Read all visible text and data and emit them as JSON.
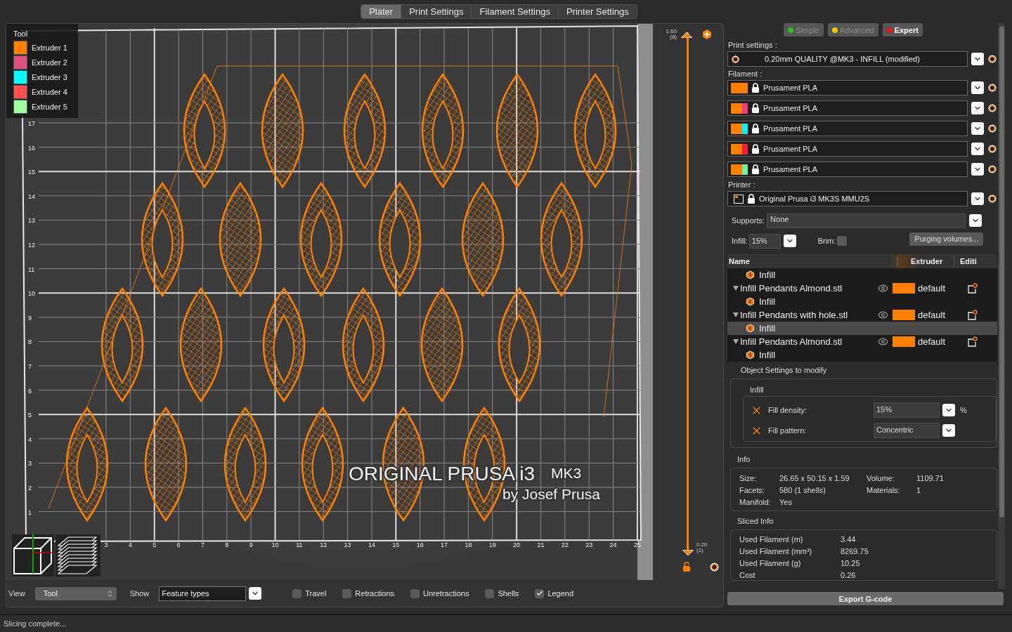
{
  "tabs": [
    {
      "label": "Plater",
      "selected": true
    },
    {
      "label": "Print Settings",
      "selected": false
    },
    {
      "label": "Filament Settings",
      "selected": false
    },
    {
      "label": "Printer Settings",
      "selected": false
    }
  ],
  "viewport": {
    "legend": {
      "title": "Tool",
      "items": [
        {
          "label": "Extruder 1",
          "color": "#ff7f00"
        },
        {
          "label": "Extruder 2",
          "color": "#e0507f"
        },
        {
          "label": "Extruder 3",
          "color": "#00ffff"
        },
        {
          "label": "Extruder 4",
          "color": "#ff4f4f"
        },
        {
          "label": "Extruder 5",
          "color": "#9eff9e"
        }
      ]
    },
    "y_axis": [
      "17",
      "16",
      "15",
      "14",
      "13",
      "12",
      "11",
      "10",
      "9",
      "8",
      "7",
      "6",
      "5",
      "4",
      "3",
      "2",
      "1"
    ],
    "x_axis": [
      "3",
      "4",
      "5",
      "6",
      "7",
      "8",
      "9",
      "10",
      "11",
      "12",
      "13",
      "14",
      "15",
      "16",
      "17",
      "18",
      "19",
      "20",
      "21",
      "22",
      "23",
      "24",
      "25"
    ],
    "bed_logo": "ORIGINAL PRUSA i3",
    "bed_model": "MK3",
    "bed_subtitle": "by Josef Prusa"
  },
  "layer_slider": {
    "upper": {
      "value": "1.60",
      "layer": "(8)",
      "level": 1
    },
    "lower": {
      "value": "0.20",
      "layer": "(1)",
      "level": 0
    }
  },
  "bottom_bar": {
    "view_label": "View",
    "view_value": "Tool",
    "show_label": "Show",
    "show_value": "Feature types",
    "options": [
      {
        "label": "Travel",
        "checked": false
      },
      {
        "label": "Retractions",
        "checked": false
      },
      {
        "label": "Unretractions",
        "checked": false
      },
      {
        "label": "Shells",
        "checked": false
      },
      {
        "label": "Legend",
        "checked": true
      }
    ]
  },
  "sidebar": {
    "modes": [
      {
        "label": "Simple",
        "color": "#22c322",
        "selected": false
      },
      {
        "label": "Advanced",
        "color": "#f0c800",
        "selected": false
      },
      {
        "label": "Expert",
        "color": "#ee1111",
        "selected": true
      }
    ],
    "print_settings": {
      "label": "Print settings :",
      "value": "0.20mm QUALITY @MK3 - INFILL (modified)"
    },
    "filament": {
      "label": "Filament :",
      "items": [
        {
          "name": "Prusament PLA",
          "color": "#ff7f00"
        },
        {
          "name": "Prusament PLA",
          "color": "#ec3c84"
        },
        {
          "name": "Prusament PLA",
          "color": "#00f0ff"
        },
        {
          "name": "Prusament PLA",
          "color": "#f5213c"
        },
        {
          "name": "Prusament PLA",
          "color": "#6cf5a0"
        }
      ]
    },
    "printer": {
      "label": "Printer :",
      "value": "Original Prusa i3 MK3S MMU2S"
    },
    "supports": {
      "label": "Supports:",
      "value": "None"
    },
    "infill": {
      "label": "Infill:",
      "value": "15%"
    },
    "brim": {
      "label": "Brim:",
      "checked": false
    },
    "purging_button": "Purging volumes...",
    "object_list": {
      "columns": [
        {
          "label": "Name"
        },
        {
          "label": "Extruder"
        },
        {
          "label": "Editi"
        }
      ],
      "items": [
        {
          "kind": "setting",
          "name": "Infill",
          "selected": false
        },
        {
          "kind": "object",
          "name": "Infill Pendants Almond.stl",
          "extruder": "default",
          "expanded": true,
          "selected": false,
          "children": [
            {
              "kind": "setting",
              "name": "Infill",
              "selected": false
            }
          ]
        },
        {
          "kind": "object",
          "name": "Infill Pendants with hole.stl",
          "extruder": "default",
          "expanded": true,
          "selected": false,
          "children": [
            {
              "kind": "setting",
              "name": "Infill",
              "selected": true
            }
          ]
        },
        {
          "kind": "object",
          "name": "Infill Pendants Almond.stl",
          "extruder": "default",
          "expanded": true,
          "selected": false,
          "children": [
            {
              "kind": "setting",
              "name": "Infill",
              "selected": false
            }
          ]
        }
      ]
    },
    "object_settings": {
      "title": "Object Settings to modify",
      "group": "Infill",
      "rows": [
        {
          "label": "Fill density:",
          "value": "15%",
          "unit": "%"
        },
        {
          "label": "Fill pattern:",
          "value": "Concentric"
        }
      ]
    },
    "info": {
      "title": "Info",
      "rows": [
        {
          "label": "Size:",
          "value": "26.65 x 50.15 x 1.59"
        },
        {
          "label": "Volume:",
          "value": "1109.71"
        },
        {
          "label": "Facets:",
          "value": "580 (1 shells)"
        },
        {
          "label": "Materials:",
          "value": "1"
        },
        {
          "label": "Manifold:",
          "value": "Yes"
        }
      ]
    },
    "sliced_info": {
      "title": "Sliced Info",
      "rows": [
        {
          "label": "Used Filament (m)",
          "value": "3.44"
        },
        {
          "label": "Used Filament (mm³)",
          "value": "8269.75"
        },
        {
          "label": "Used Filament (g)",
          "value": "10.25"
        },
        {
          "label": "Cost",
          "value": "0.26"
        }
      ]
    },
    "export_button": "Export G-code"
  },
  "status_bar": "Slicing complete..."
}
